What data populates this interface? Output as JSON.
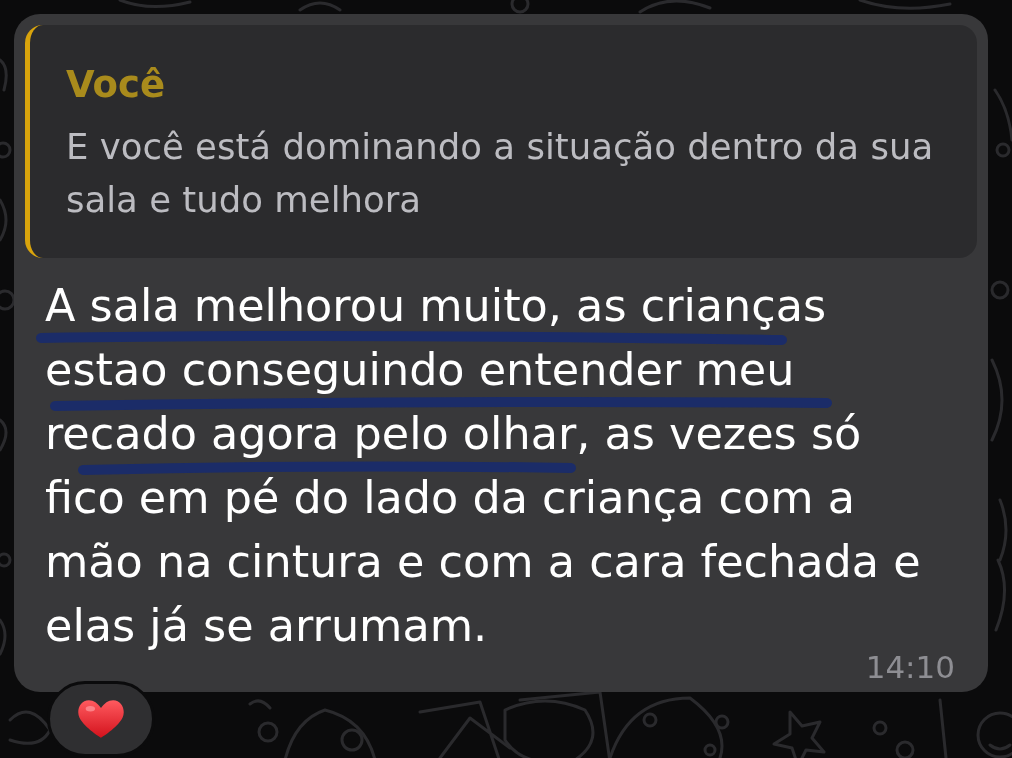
{
  "wallpaper": {
    "kind": "doodles"
  },
  "message": {
    "reply_quote": {
      "author": "Você",
      "text": "E você está dominando a situação dentro da sua sala e tudo melhora"
    },
    "text": "A sala melhorou muito, as crianças estao conseguindo entender meu recado agora pelo olhar, as vezes só fico em pé do lado da criança com a mão na cintura e com a cara fechada e elas já se arrumam.",
    "pen_underlines": true,
    "time": "14:10",
    "reactions": [
      {
        "kind": "heart"
      }
    ]
  }
}
